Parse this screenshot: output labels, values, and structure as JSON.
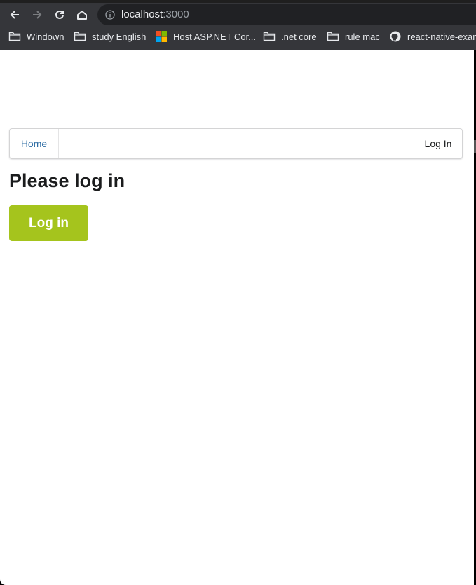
{
  "browser": {
    "url": {
      "host": "localhost",
      "port": ":3000"
    },
    "bookmarks": [
      {
        "label": "Windown",
        "icon": "folder-icon"
      },
      {
        "label": "study English",
        "icon": "folder-icon"
      },
      {
        "label": "Host ASP.NET Cor...",
        "icon": "microsoft-icon"
      },
      {
        "label": ".net core",
        "icon": "folder-icon"
      },
      {
        "label": "rule mac",
        "icon": "folder-icon"
      },
      {
        "label": "react-native-exam",
        "icon": "github-icon"
      }
    ]
  },
  "menu": {
    "home_label": "Home",
    "login_label": "Log In"
  },
  "main": {
    "heading": "Please log in",
    "login_button_label": "Log in"
  },
  "colors": {
    "accent": "#a5c41d",
    "link": "#2f6ea5",
    "chrome": "#35363a"
  }
}
